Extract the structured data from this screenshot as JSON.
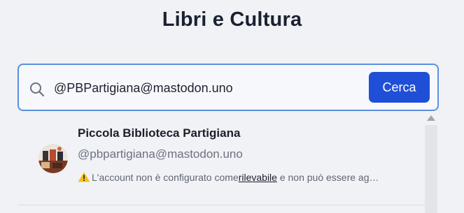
{
  "header": {
    "title": "Libri e Cultura"
  },
  "search": {
    "value": "@PBPartigiana@mastodon.uno",
    "button_label": "Cerca",
    "icon": "search-icon"
  },
  "results": [
    {
      "name": "Piccola Biblioteca Partigiana",
      "handle": "@pbpartigiana@mastodon.uno",
      "warning_prefix": "L'account non è configurato come",
      "warning_link": "rilevabile",
      "warning_suffix": " e non può essere ag…",
      "warning_icon": "warning-icon"
    }
  ],
  "colors": {
    "accent": "#1f4fd7",
    "focus_border": "#5b8fe0",
    "warning": "#f3c218"
  }
}
